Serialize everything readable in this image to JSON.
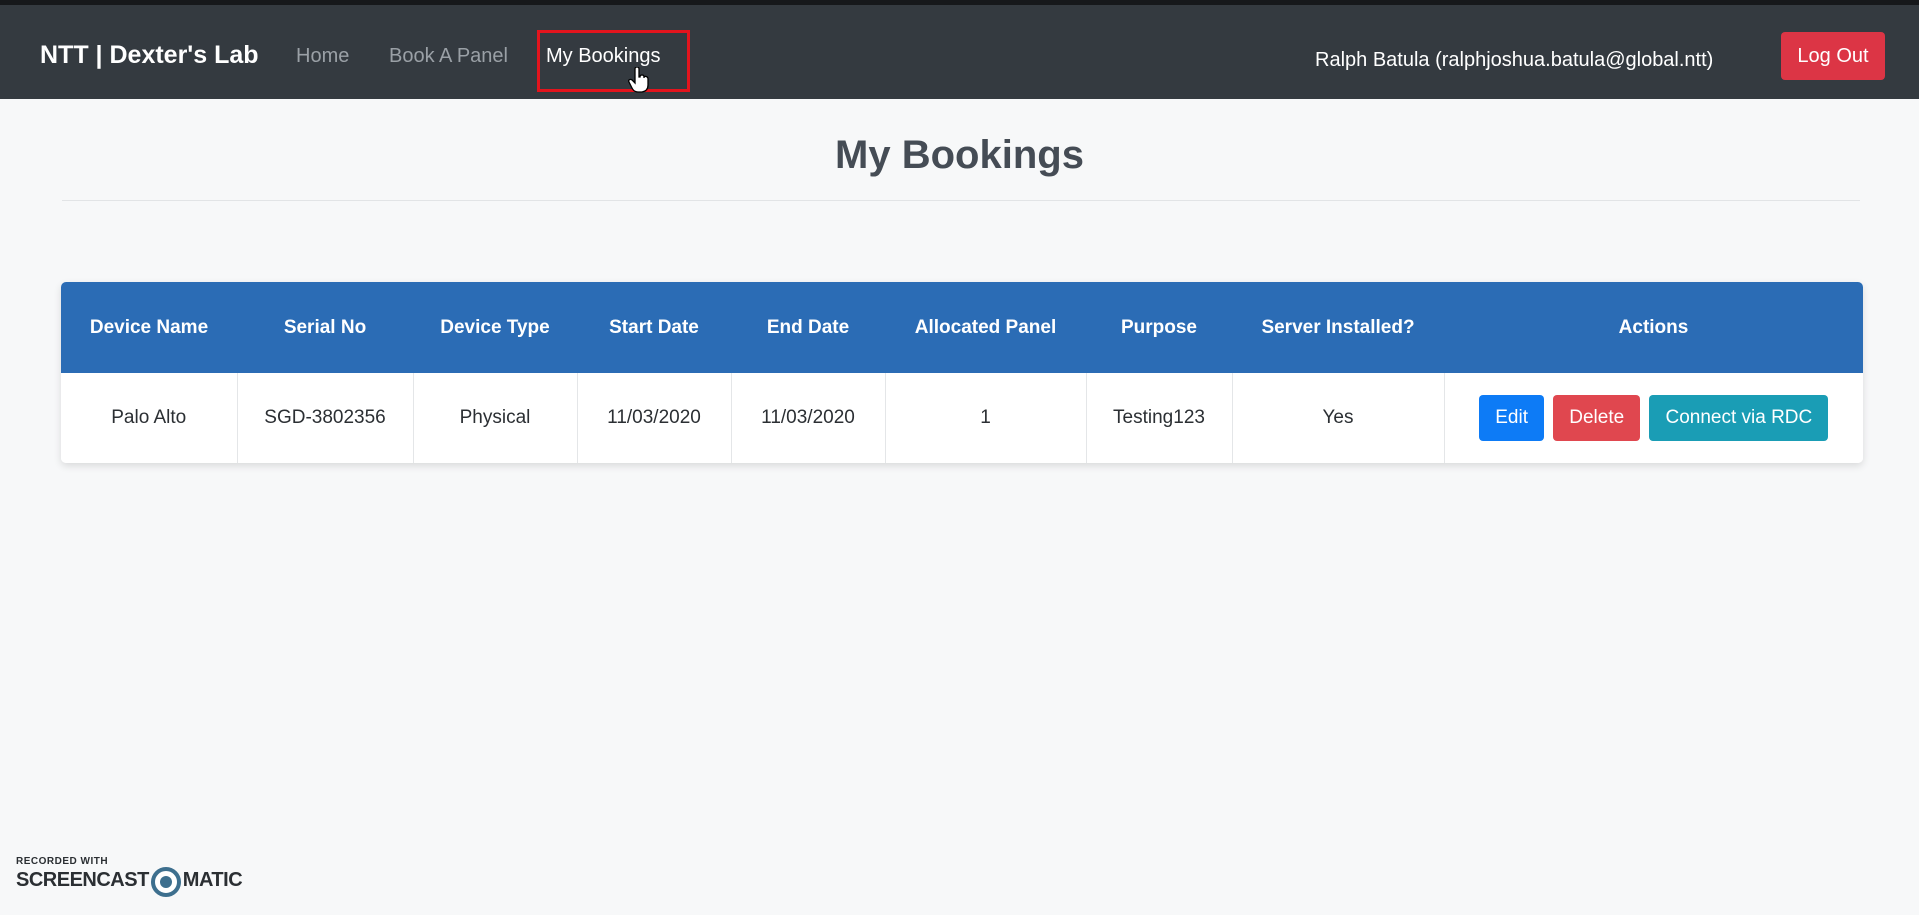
{
  "navbar": {
    "brand": "NTT | Dexter's Lab",
    "links": [
      "Home",
      "Book A Panel",
      "My Bookings"
    ],
    "user": "Ralph Batula (ralphjoshua.batula@global.ntt)",
    "logout": "Log Out"
  },
  "page": {
    "title": "My Bookings"
  },
  "table": {
    "headers": [
      "Device Name",
      "Serial No",
      "Device Type",
      "Start Date",
      "End Date",
      "Allocated Panel",
      "Purpose",
      "Server Installed?",
      "Actions"
    ],
    "rows": [
      {
        "cells": [
          "Palo Alto",
          "SGD-3802356",
          "Physical",
          "11/03/2020",
          "11/03/2020",
          "1",
          "Testing123",
          "Yes"
        ],
        "actions": [
          "Edit",
          "Delete",
          "Connect via RDC"
        ]
      }
    ]
  },
  "watermark": {
    "line1": "RECORDED WITH",
    "line2a": "SCREENCAST",
    "line2b": "MATIC"
  },
  "colors": {
    "navbar": "#343a40",
    "table_header": "#2b6cb5",
    "edit": "#0d7bf6",
    "delete": "#e0474f",
    "rdc": "#1a9db5",
    "logout": "#dc3545"
  }
}
